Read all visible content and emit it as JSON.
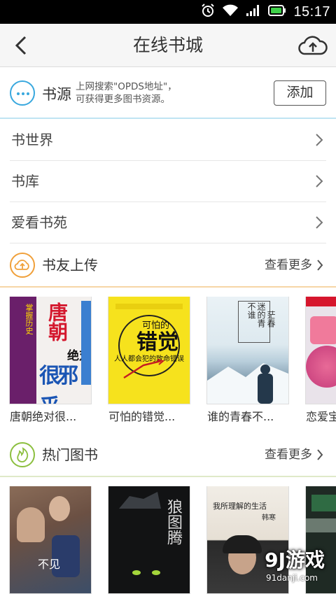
{
  "status_bar": {
    "time": "15:17"
  },
  "nav": {
    "title": "在线书城"
  },
  "source": {
    "title": "书源",
    "desc_line1": "上网搜索\"OPDS地址\"，",
    "desc_line2": "可获得更多图书资源。",
    "add_label": "添加"
  },
  "categories": [
    {
      "label": "书世界"
    },
    {
      "label": "书库"
    },
    {
      "label": "爱看书苑"
    }
  ],
  "uploads": {
    "title": "书友上传",
    "more": "查看更多",
    "books": [
      {
        "title": "唐朝绝对很...",
        "cover_text_a": "唐朝",
        "cover_text_b": "绝对",
        "cover_text_c": "很邪乎"
      },
      {
        "title": "可怕的错觉...",
        "cover_text_a": "可怕的",
        "cover_text_b": "错觉",
        "cover_text_c": "人人都会犯的致命错误"
      },
      {
        "title": "谁的青春不...",
        "cover_text_a": "不谁",
        "cover_text_b": "迷的青",
        "cover_text_c": "茫春"
      },
      {
        "title": "恋爱宝"
      }
    ]
  },
  "hot": {
    "title": "热门图书",
    "more": "查看更多",
    "books": [
      {
        "cover_text_a": "不见"
      },
      {
        "cover_text_a": "狼图腾"
      },
      {
        "cover_text_a": "我所理解的生活",
        "cover_text_b": "韩寒"
      },
      {}
    ]
  },
  "watermark": {
    "big": "9J游戏",
    "small": "91danji.com"
  },
  "colors": {
    "accent_blue": "#39a8de",
    "accent_orange": "#f0a03a",
    "accent_green": "#8cbf3f"
  }
}
